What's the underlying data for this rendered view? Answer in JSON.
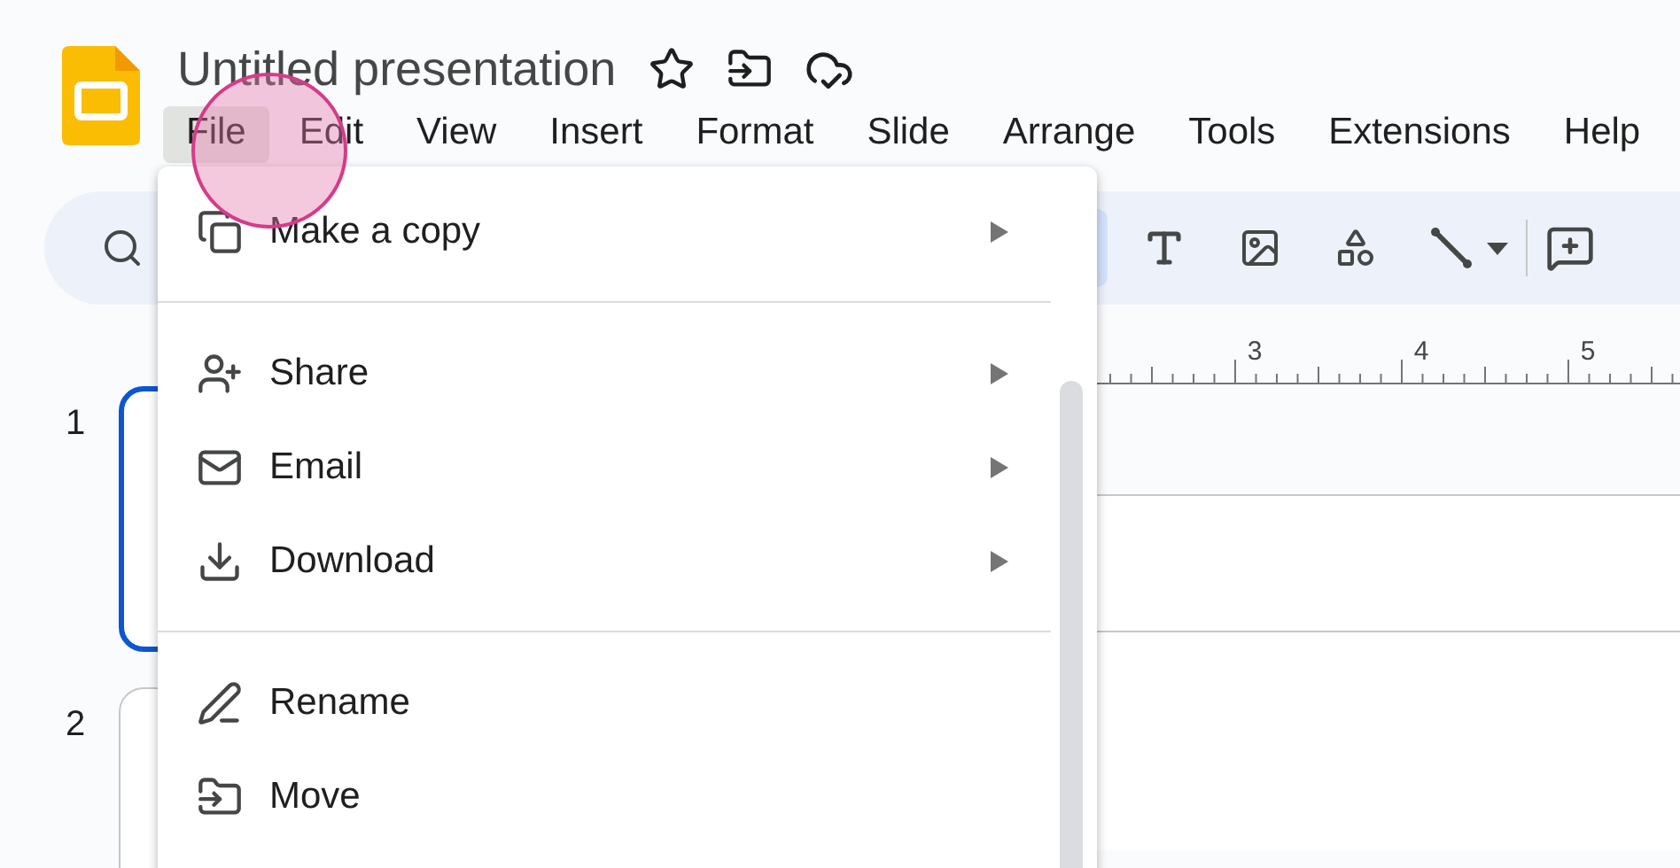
{
  "document": {
    "title": "Untitled presentation"
  },
  "menu_bar": [
    {
      "label": "File",
      "selected": true
    },
    {
      "label": "Edit",
      "selected": false
    },
    {
      "label": "View",
      "selected": false
    },
    {
      "label": "Insert",
      "selected": false
    },
    {
      "label": "Format",
      "selected": false
    },
    {
      "label": "Slide",
      "selected": false
    },
    {
      "label": "Arrange",
      "selected": false
    },
    {
      "label": "Tools",
      "selected": false
    },
    {
      "label": "Extensions",
      "selected": false
    },
    {
      "label": "Help",
      "selected": false
    }
  ],
  "file_menu": [
    {
      "kind": "item",
      "label": "Make a copy",
      "submenu": true
    },
    {
      "kind": "divider"
    },
    {
      "kind": "item",
      "label": "Share",
      "submenu": true
    },
    {
      "kind": "item",
      "label": "Email",
      "submenu": true
    },
    {
      "kind": "item",
      "label": "Download",
      "submenu": true
    },
    {
      "kind": "divider"
    },
    {
      "kind": "item",
      "label": "Rename",
      "submenu": false
    },
    {
      "kind": "item",
      "label": "Move",
      "submenu": false
    }
  ],
  "toolbar": [
    {
      "selected": true
    },
    {
      "selected": false
    },
    {
      "selected": false
    },
    {
      "selected": false
    },
    {
      "selected": false
    }
  ],
  "ruler": {
    "labels": [
      "3",
      "4",
      "5"
    ]
  },
  "slides": [
    {
      "number": "1",
      "selected": true
    },
    {
      "number": "2",
      "selected": false
    }
  ]
}
